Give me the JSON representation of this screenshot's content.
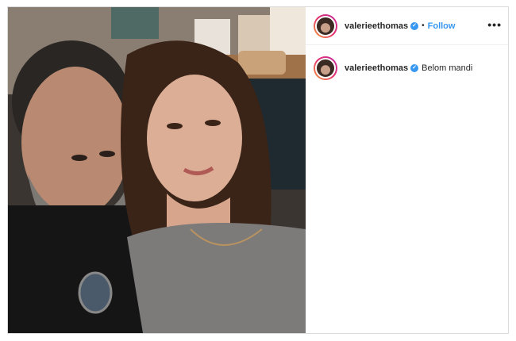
{
  "post": {
    "photo": {
      "alt": ""
    },
    "header": {
      "username": "valerieethomas",
      "verified": true,
      "separator": "•",
      "follow_label": "Follow",
      "more_glyph": "•••"
    },
    "caption": {
      "username": "valerieethomas",
      "verified": true,
      "text": "Belom mandi"
    }
  },
  "colors": {
    "link_blue": "#3897f0",
    "text": "#262626",
    "border": "#dbdbdb"
  },
  "icons": [
    "verified-badge-icon",
    "more-options-icon"
  ]
}
